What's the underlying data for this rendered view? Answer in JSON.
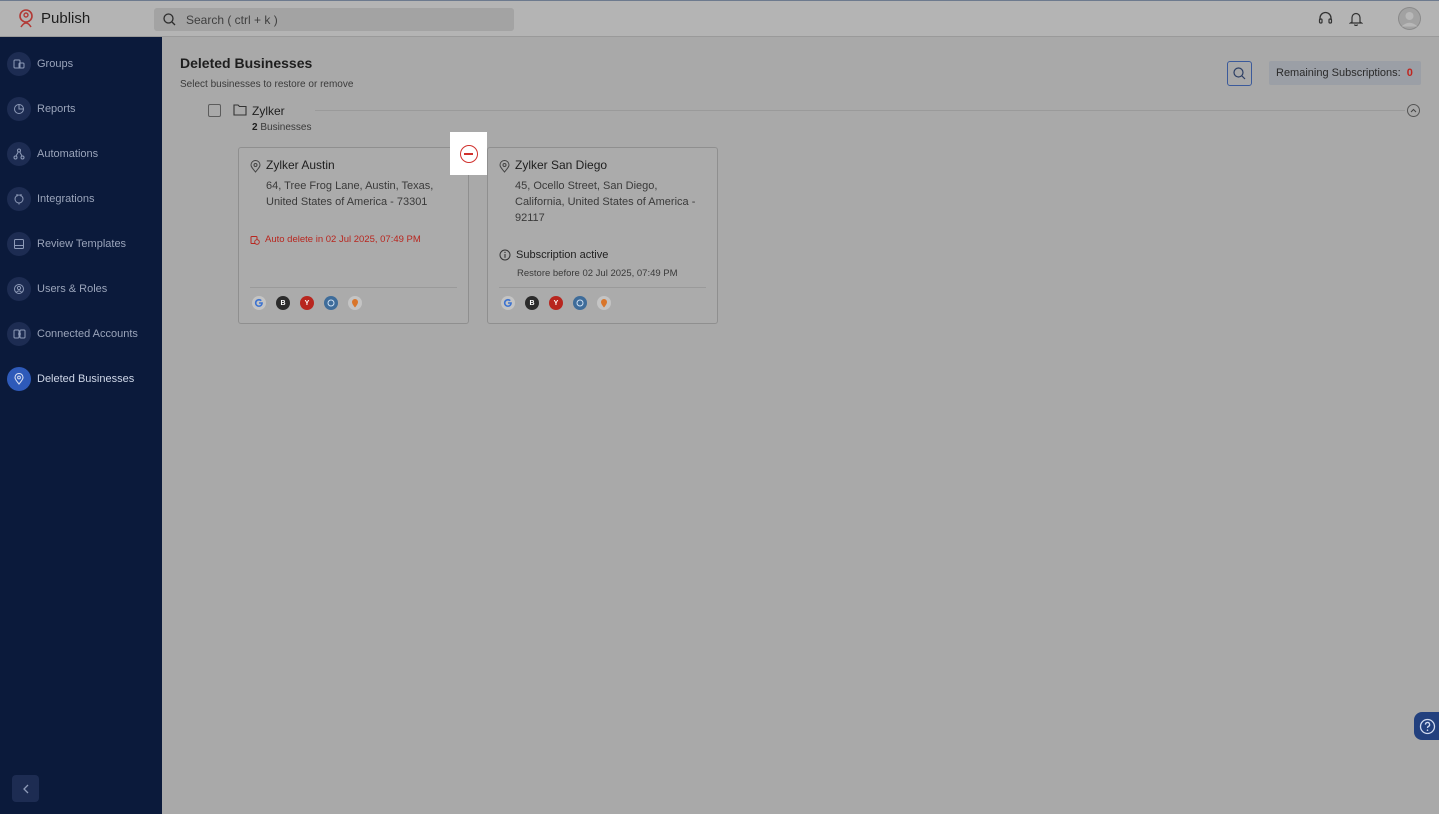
{
  "app": {
    "name": "Publish",
    "search_placeholder": "Search ( ctrl + k )"
  },
  "topbar_icons": [
    "headset-icon",
    "bell-icon",
    "avatar"
  ],
  "sidebar": {
    "items": [
      {
        "label": "Groups",
        "icon": "groups-icon",
        "active": false
      },
      {
        "label": "Reports",
        "icon": "reports-icon",
        "active": false
      },
      {
        "label": "Automations",
        "icon": "automations-icon",
        "active": false
      },
      {
        "label": "Integrations",
        "icon": "integrations-icon",
        "active": false
      },
      {
        "label": "Review Templates",
        "icon": "review-templates-icon",
        "active": false
      },
      {
        "label": "Users & Roles",
        "icon": "users-roles-icon",
        "active": false
      },
      {
        "label": "Connected Accounts",
        "icon": "connected-accounts-icon",
        "active": false
      },
      {
        "label": "Deleted Businesses",
        "icon": "deleted-businesses-icon",
        "active": true
      }
    ]
  },
  "main": {
    "title": "Deleted Businesses",
    "subtitle": "Select businesses to restore or remove",
    "remaining_label": "Remaining Subscriptions:",
    "remaining_count": "0",
    "group": {
      "name": "Zylker",
      "count": "2",
      "count_label": "Businesses"
    },
    "cards": [
      {
        "name": "Zylker Austin",
        "address": "64, Tree Frog Lane, Austin, Texas, United States of America - 73301",
        "auto_delete": "Auto delete in 02 Jul 2025, 07:49 PM"
      },
      {
        "name": "Zylker San Diego",
        "address": "45, Ocello Street, San Diego, California, United States of America - 92117",
        "subscription_status": "Subscription active",
        "restore_before": "Restore before 02 Jul 2025, 07:49 PM"
      }
    ],
    "platforms": [
      "google-icon",
      "bing-icon",
      "yelp-icon",
      "apple-maps-icon",
      "foursquare-icon"
    ]
  },
  "colors": {
    "sidebar_bg": "#0b1a3b",
    "active_icon": "#2e5ab9",
    "danger": "#c0251f"
  }
}
